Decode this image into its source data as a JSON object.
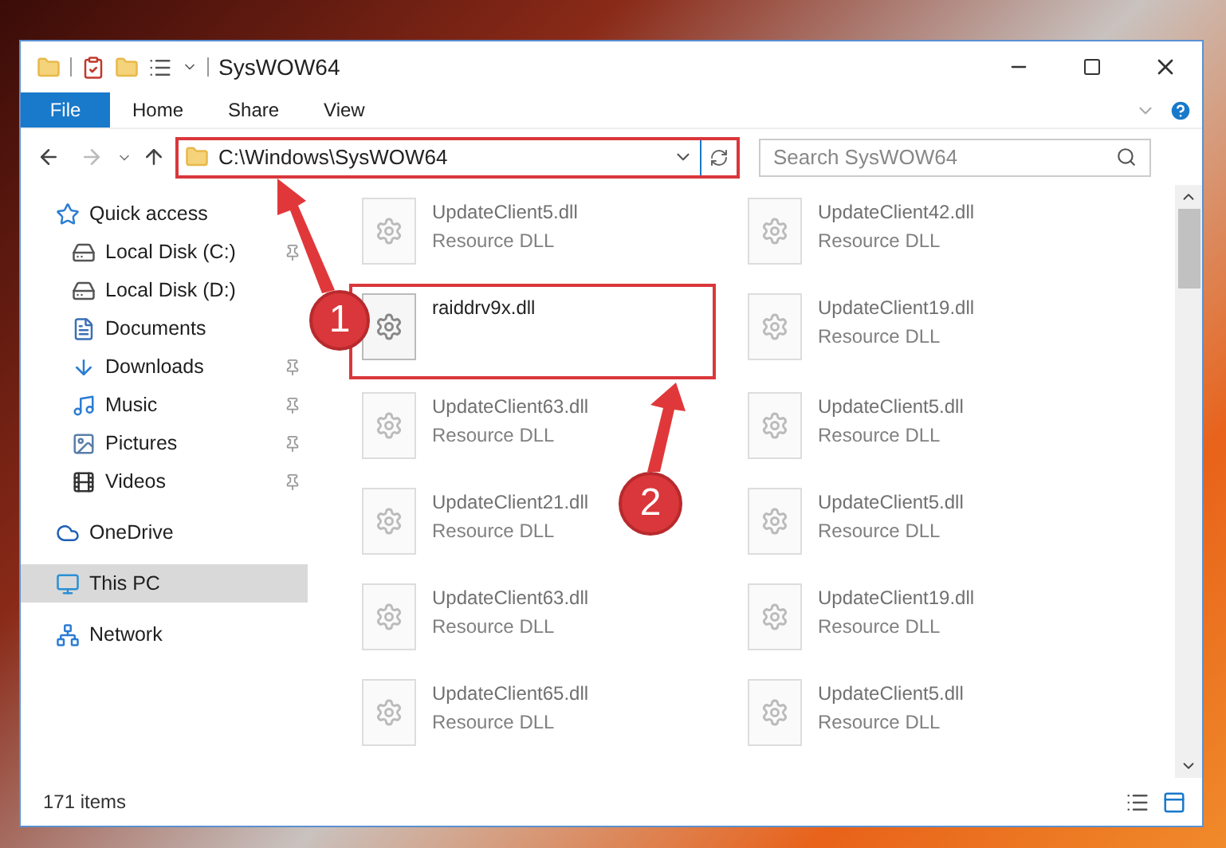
{
  "window": {
    "title": "SysWOW64"
  },
  "ribbon_tabs": [
    {
      "label": "File",
      "selected": true
    },
    {
      "label": "Home",
      "selected": false
    },
    {
      "label": "Share",
      "selected": false
    },
    {
      "label": "View",
      "selected": false
    }
  ],
  "address": {
    "path": "C:\\Windows\\SysWOW64"
  },
  "search": {
    "placeholder": "Search SysWOW64"
  },
  "sidebar": {
    "items": [
      {
        "label": "Quick access",
        "kind": "star",
        "selected": false,
        "children": [
          {
            "label": "Local Disk (C:)",
            "kind": "disk-c",
            "pinned": true,
            "selected": false
          },
          {
            "label": "Local Disk (D:)",
            "kind": "disk",
            "selected": false
          },
          {
            "label": "Documents",
            "kind": "documents",
            "selected": false
          },
          {
            "label": "Downloads",
            "kind": "downloads",
            "pinned": true,
            "selected": false
          },
          {
            "label": "Music",
            "kind": "music",
            "pinned": true,
            "selected": false
          },
          {
            "label": "Pictures",
            "kind": "pictures",
            "pinned": true,
            "selected": false
          },
          {
            "label": "Videos",
            "kind": "videos",
            "pinned": true,
            "selected": false
          }
        ]
      },
      {
        "label": "OneDrive",
        "kind": "cloud",
        "selected": false
      },
      {
        "label": "This PC",
        "kind": "pc",
        "selected": true
      },
      {
        "label": "Network",
        "kind": "network",
        "selected": false
      }
    ]
  },
  "files": [
    {
      "name": "UpdateClient5.dll",
      "type": "Resource DLL",
      "highlighted": false
    },
    {
      "name": "UpdateClient42.dll",
      "type": "Resource DLL",
      "highlighted": false
    },
    {
      "name": "raiddrv9x.dll",
      "highlighted": true
    },
    {
      "name": "UpdateClient19.dll",
      "type": "Resource DLL",
      "highlighted": false
    },
    {
      "name": "UpdateClient63.dll",
      "type": "Resource DLL",
      "highlighted": false
    },
    {
      "name": "UpdateClient5.dll",
      "type": "Resource DLL",
      "highlighted": false
    },
    {
      "name": "UpdateClient21.dll",
      "type": "Resource DLL",
      "highlighted": false
    },
    {
      "name": "UpdateClient5.dll",
      "type": "Resource DLL",
      "highlighted": false
    },
    {
      "name": "UpdateClient63.dll",
      "type": "Resource DLL",
      "highlighted": false
    },
    {
      "name": "UpdateClient19.dll",
      "type": "Resource DLL",
      "highlighted": false
    },
    {
      "name": "UpdateClient65.dll",
      "type": "Resource DLL",
      "highlighted": false
    },
    {
      "name": "UpdateClient5.dll",
      "type": "Resource DLL",
      "highlighted": false
    }
  ],
  "status_bar": {
    "count": "171 items"
  },
  "callouts": [
    {
      "number": "1"
    },
    {
      "number": "2"
    }
  ]
}
